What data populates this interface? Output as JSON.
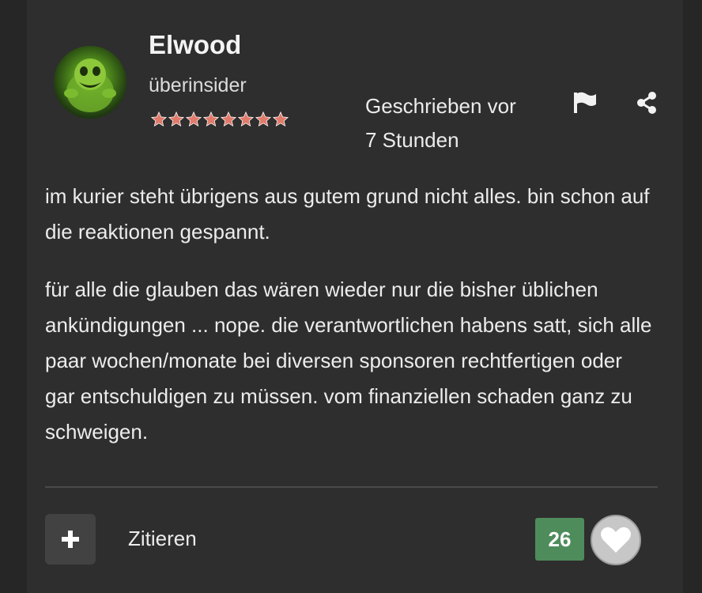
{
  "post": {
    "author": {
      "name": "Elwood",
      "rank": "überinsider",
      "stars": 8,
      "avatar_icon": "green-ghost-avatar"
    },
    "timestamp_line1": "Geschrieben vor",
    "timestamp_line2": "7 Stunden",
    "actions": {
      "flag_icon": "flag-icon",
      "share_icon": "share-icon"
    },
    "paragraphs": [
      "im kurier steht übrigens aus gutem grund nicht alles. bin schon auf die reaktionen gespannt.",
      "für alle die glauben das wären wieder nur die bisher üblichen ankündigungen ... nope. die verantwortlichen habens satt, sich alle paar wochen/monate bei diversen sponsoren rechtfertigen oder gar entschuldigen zu müssen. vom finanziellen schaden ganz zu schweigen."
    ],
    "footer": {
      "plus_icon": "plus-icon",
      "quote_label": "Zitieren",
      "reaction_count": "26",
      "like_icon": "heart-icon"
    }
  },
  "colors": {
    "page_bg": "#262626",
    "post_bg": "#2e2e2e",
    "star_color": "#e07a6a",
    "reaction_bg": "#4f8c5c",
    "like_bg": "#c7c7c7"
  }
}
